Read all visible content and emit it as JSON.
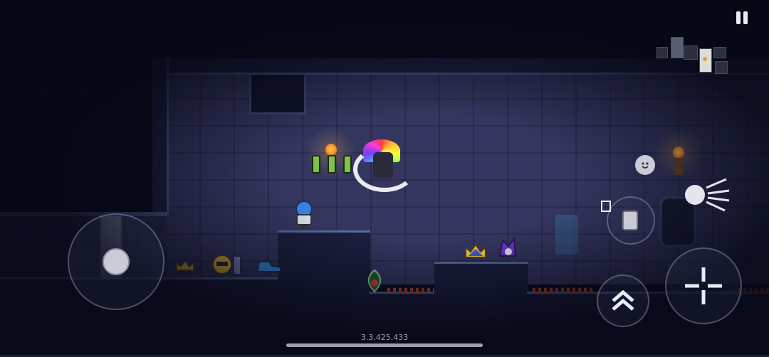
{
  "game": {
    "version": "3.3.425.433",
    "hud": {
      "pause_icon": "pause-icon",
      "minimap_icon": "minimap-icon",
      "jump_icon": "double-chevron-up-icon",
      "attack_icon": "crosshair-icon",
      "skill_icon": "dash-orb-icon",
      "weapon_swap_icon": "weapon-card-icon",
      "emote_icon": "smiley-icon",
      "joystick_icon": "joystick-knob-icon"
    },
    "items": [
      {
        "name": "golden-crown-icon"
      },
      {
        "name": "armor-set-icon"
      },
      {
        "name": "blue-boots-icon"
      },
      {
        "name": "pet-egg-icon"
      },
      {
        "name": "flame-amulet-icon"
      },
      {
        "name": "purple-crown-icon"
      },
      {
        "name": "jester-hat-icon"
      }
    ],
    "colors": {
      "background": "#070a1a",
      "wall": "#34365f",
      "spike": "#b3462f",
      "torch_flame": "#ffb13b"
    }
  }
}
